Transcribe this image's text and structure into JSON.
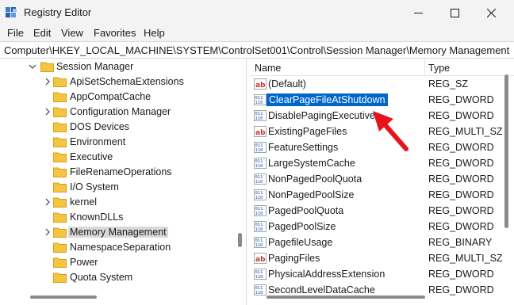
{
  "window": {
    "title": "Registry Editor",
    "minimize_glyph": "—",
    "maximize_glyph": "☐",
    "close_glyph": "✕"
  },
  "menu": [
    "File",
    "Edit",
    "View",
    "Favorites",
    "Help"
  ],
  "address": "Computer\\HKEY_LOCAL_MACHINE\\SYSTEM\\ControlSet001\\Control\\Session Manager\\Memory Management",
  "tree": {
    "parent": {
      "label": "Session Manager",
      "expanded": true
    },
    "children": [
      {
        "label": "ApiSetSchemaExtensions",
        "expandable": true
      },
      {
        "label": "AppCompatCache",
        "expandable": false
      },
      {
        "label": "Configuration Manager",
        "expandable": true
      },
      {
        "label": "DOS Devices",
        "expandable": false
      },
      {
        "label": "Environment",
        "expandable": false
      },
      {
        "label": "Executive",
        "expandable": false
      },
      {
        "label": "FileRenameOperations",
        "expandable": false
      },
      {
        "label": "I/O System",
        "expandable": false
      },
      {
        "label": "kernel",
        "expandable": true
      },
      {
        "label": "KnownDLLs",
        "expandable": false
      },
      {
        "label": "Memory Management",
        "expandable": true,
        "selected": true
      },
      {
        "label": "NamespaceSeparation",
        "expandable": false
      },
      {
        "label": "Power",
        "expandable": false
      },
      {
        "label": "Quota System",
        "expandable": false
      }
    ]
  },
  "list": {
    "columns": {
      "name": "Name",
      "type": "Type"
    },
    "rows": [
      {
        "name": "(Default)",
        "type": "REG_SZ",
        "icon": "string-value-icon"
      },
      {
        "name": "ClearPageFileAtShutdown",
        "type": "REG_DWORD",
        "icon": "binary-value-icon",
        "selected": true
      },
      {
        "name": "DisablePagingExecutive",
        "type": "REG_DWORD",
        "icon": "binary-value-icon"
      },
      {
        "name": "ExistingPageFiles",
        "type": "REG_MULTI_SZ",
        "icon": "string-value-icon"
      },
      {
        "name": "FeatureSettings",
        "type": "REG_DWORD",
        "icon": "binary-value-icon"
      },
      {
        "name": "LargeSystemCache",
        "type": "REG_DWORD",
        "icon": "binary-value-icon"
      },
      {
        "name": "NonPagedPoolQuota",
        "type": "REG_DWORD",
        "icon": "binary-value-icon"
      },
      {
        "name": "NonPagedPoolSize",
        "type": "REG_DWORD",
        "icon": "binary-value-icon"
      },
      {
        "name": "PagedPoolQuota",
        "type": "REG_DWORD",
        "icon": "binary-value-icon"
      },
      {
        "name": "PagedPoolSize",
        "type": "REG_DWORD",
        "icon": "binary-value-icon"
      },
      {
        "name": "PagefileUsage",
        "type": "REG_BINARY",
        "icon": "binary-value-icon"
      },
      {
        "name": "PagingFiles",
        "type": "REG_MULTI_SZ",
        "icon": "string-value-icon"
      },
      {
        "name": "PhysicalAddressExtension",
        "type": "REG_DWORD",
        "icon": "binary-value-icon"
      },
      {
        "name": "SecondLevelDataCache",
        "type": "REG_DWORD",
        "icon": "binary-value-icon"
      }
    ]
  },
  "colors": {
    "selection": "#0066cc",
    "annotation_arrow": "#e8141c",
    "folder": "#f5c542"
  }
}
